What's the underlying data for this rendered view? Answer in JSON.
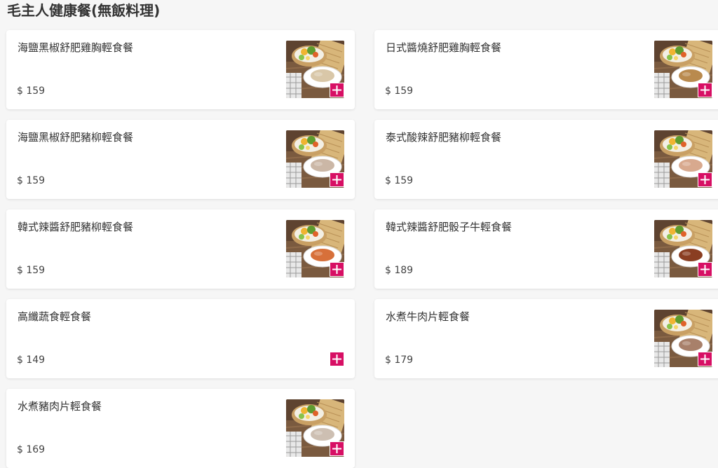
{
  "section": {
    "title": "毛主人健康餐(無飯料理)"
  },
  "colors": {
    "accent": "#d70f64",
    "card_bg": "#ffffff",
    "page_bg": "#f6f6f6"
  },
  "items": [
    {
      "name": "海鹽黑椒舒肥雞胸輕食餐",
      "price": "$ 159",
      "has_image": true,
      "image_icon": "dish-photo-chicken"
    },
    {
      "name": "日式醬燒舒肥雞胸輕食餐",
      "price": "$ 159",
      "has_image": true,
      "image_icon": "dish-photo-chicken"
    },
    {
      "name": "海鹽黑椒舒肥豬柳輕食餐",
      "price": "$ 159",
      "has_image": true,
      "image_icon": "dish-photo-pork"
    },
    {
      "name": "泰式酸辣舒肥豬柳輕食餐",
      "price": "$ 159",
      "has_image": true,
      "image_icon": "dish-photo-pork"
    },
    {
      "name": "韓式辣醬舒肥豬柳輕食餐",
      "price": "$ 159",
      "has_image": true,
      "image_icon": "dish-photo-pork"
    },
    {
      "name": "韓式辣醬舒肥骰子牛輕食餐",
      "price": "$ 189",
      "has_image": true,
      "image_icon": "dish-photo-beef"
    },
    {
      "name": "高纖蔬食輕食餐",
      "price": "$ 149",
      "has_image": false,
      "image_icon": ""
    },
    {
      "name": "水煮牛肉片輕食餐",
      "price": "$ 179",
      "has_image": true,
      "image_icon": "dish-photo-beef"
    },
    {
      "name": "水煮豬肉片輕食餐",
      "price": "$ 169",
      "has_image": true,
      "image_icon": "dish-photo-pork"
    }
  ]
}
